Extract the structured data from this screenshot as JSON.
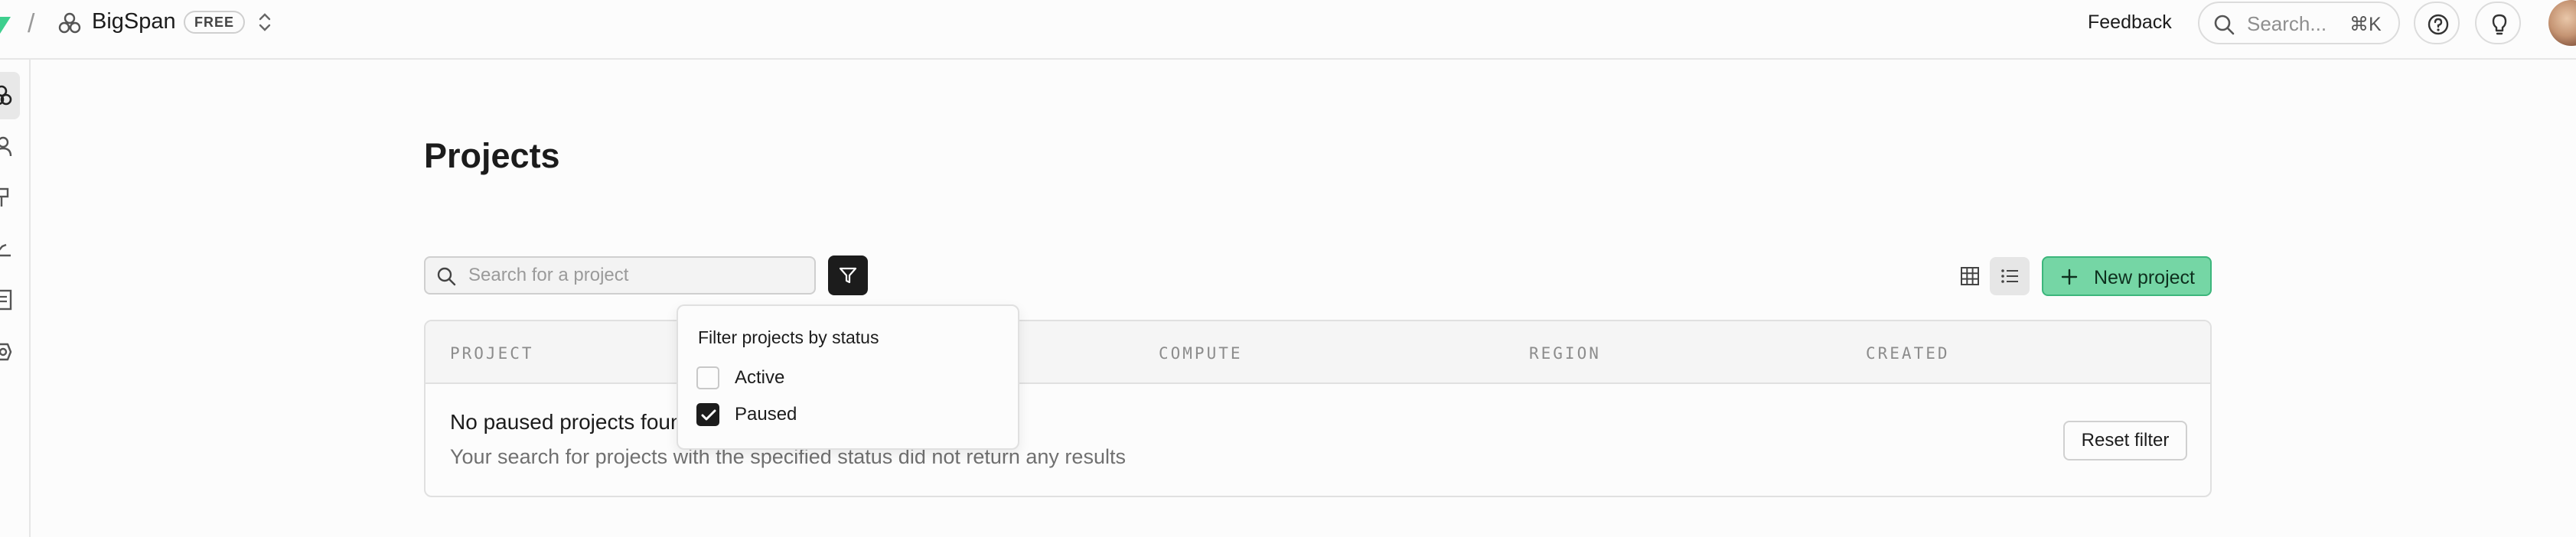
{
  "topbar": {
    "separator": "/",
    "org_name": "BigSpan",
    "plan_badge": "FREE",
    "feedback_label": "Feedback",
    "search_placeholder": "Search...",
    "search_shortcut": "⌘K"
  },
  "sidebar": {
    "items": [
      {
        "icon": "projects-icon",
        "active": true
      },
      {
        "icon": "team-icon",
        "active": false
      },
      {
        "icon": "integrations-icon",
        "active": false
      },
      {
        "icon": "usage-icon",
        "active": false
      },
      {
        "icon": "billing-icon",
        "active": false
      },
      {
        "icon": "settings-icon",
        "active": false
      }
    ]
  },
  "main": {
    "title": "Projects",
    "search_placeholder": "Search for a project",
    "new_project_label": "New project",
    "table": {
      "columns": [
        "PROJECT",
        "COMPUTE",
        "REGION",
        "CREATED"
      ],
      "empty_title": "No paused projects found",
      "empty_description": "Your search for projects with the specified status did not return any results",
      "reset_label": "Reset filter"
    }
  },
  "filter_dropdown": {
    "title": "Filter projects by status",
    "options": [
      {
        "label": "Active",
        "checked": false
      },
      {
        "label": "Paused",
        "checked": true
      }
    ]
  },
  "colors": {
    "brand_green": "#3ecf8e",
    "new_project_bg": "#75d6a5",
    "dark": "#1c1c1c"
  }
}
